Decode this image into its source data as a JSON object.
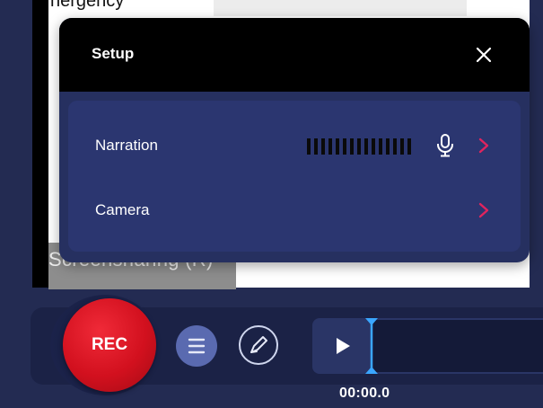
{
  "background": {
    "top_text": "nergency",
    "strip_text": "Screensharing (R)"
  },
  "setup_dialog": {
    "title": "Setup",
    "close_icon": "close-icon",
    "rows": [
      {
        "label": "Narration",
        "meter_icon": "audio-level-meter",
        "mic_icon": "microphone-icon",
        "chevron_icon": "chevron-right-icon"
      },
      {
        "label": "Camera",
        "chevron_icon": "chevron-right-icon"
      }
    ]
  },
  "toolbar": {
    "rec_label": "REC",
    "menu_icon": "menu-icon",
    "draw_icon": "pen-icon",
    "play_icon": "play-icon",
    "time": "00:00.0"
  },
  "colors": {
    "accent": "#e0245e",
    "rec": "#d2101e",
    "panel": "#263060",
    "playhead": "#3aa6ff"
  }
}
